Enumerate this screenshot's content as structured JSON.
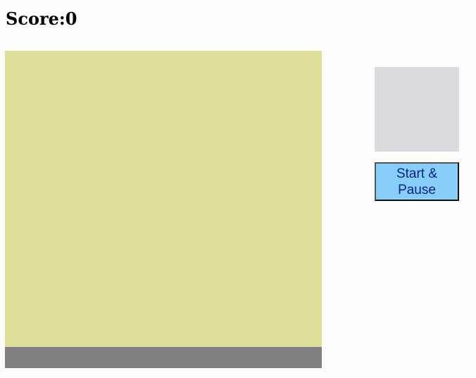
{
  "score": {
    "text": "Score:0",
    "value": 0
  },
  "board": {
    "color": "#dfdf9c",
    "floor_color": "#808080"
  },
  "next_piece_preview": {
    "color": "#dcdce0"
  },
  "controls": {
    "start_pause_label": "Start & Pause",
    "button_color": "#87cefa"
  }
}
